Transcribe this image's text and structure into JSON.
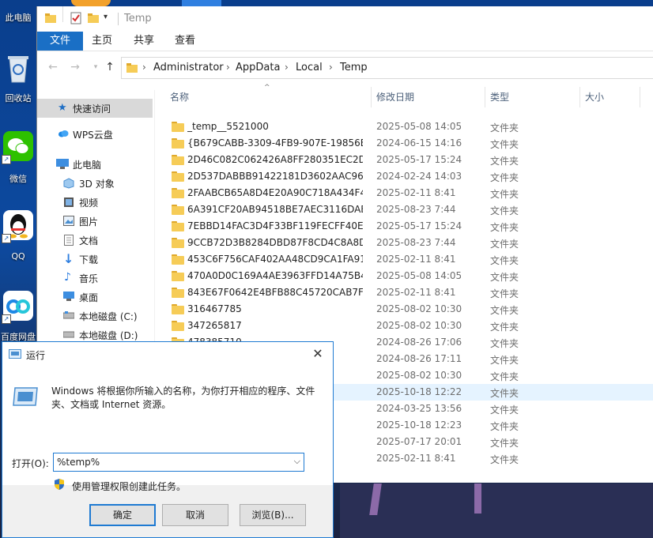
{
  "desktop": {
    "icons": [
      {
        "label": "此电脑",
        "icon": "computer-icon"
      },
      {
        "label": "回收站",
        "icon": "recycle-bin-icon"
      },
      {
        "label": "微信",
        "icon": "wechat-icon"
      },
      {
        "label": "QQ",
        "icon": "qq-icon"
      },
      {
        "label": "百度网盘",
        "icon": "baidu-netdisk-icon"
      }
    ]
  },
  "explorer": {
    "title": "Temp",
    "ribbon_tabs": [
      "文件",
      "主页",
      "共享",
      "查看"
    ],
    "breadcrumb": [
      "Administrator",
      "AppData",
      "Local",
      "Temp"
    ],
    "nav": [
      {
        "label": "快速访问",
        "icon": "star-icon"
      },
      {
        "label": "WPS云盘",
        "icon": "cloud-icon"
      },
      {
        "label": "此电脑",
        "icon": "computer-icon"
      },
      {
        "label": "3D 对象",
        "icon": "cube-icon"
      },
      {
        "label": "视频",
        "icon": "video-icon"
      },
      {
        "label": "图片",
        "icon": "picture-icon"
      },
      {
        "label": "文档",
        "icon": "document-icon"
      },
      {
        "label": "下载",
        "icon": "download-icon"
      },
      {
        "label": "音乐",
        "icon": "music-icon"
      },
      {
        "label": "桌面",
        "icon": "desktop-icon"
      },
      {
        "label": "本地磁盘 (C:)",
        "icon": "drive-icon"
      },
      {
        "label": "本地磁盘 (D:)",
        "icon": "drive-icon"
      }
    ],
    "columns": {
      "name": "名称",
      "date": "修改日期",
      "type": "类型",
      "size": "大小"
    },
    "files": [
      {
        "name": "_temp__5521000",
        "date": "2025-05-08 14:05",
        "type": "文件夹"
      },
      {
        "name": "{B679CABB-3309-4FB9-907E-19856E...",
        "date": "2024-06-15 14:16",
        "type": "文件夹"
      },
      {
        "name": "2D46C082C062426A8FF280351EC2D7...",
        "date": "2025-05-17 15:24",
        "type": "文件夹"
      },
      {
        "name": "2D537DABBB91422181D3602AAC96...",
        "date": "2024-02-24 14:03",
        "type": "文件夹"
      },
      {
        "name": "2FAABCB65A8D4E20A90C718A434F4...",
        "date": "2025-02-11 8:41",
        "type": "文件夹"
      },
      {
        "name": "6A391CF20AB94518BE7AEC3116DAB...",
        "date": "2025-08-23 7:44",
        "type": "文件夹"
      },
      {
        "name": "7EBBD14FAC3D4F33BF119FECFF40EE...",
        "date": "2025-05-17 15:24",
        "type": "文件夹"
      },
      {
        "name": "9CCB72D3B8284DBD87F8CD4C8A8D...",
        "date": "2025-08-23 7:44",
        "type": "文件夹"
      },
      {
        "name": "453C6F756CAF402AA48CD9CA1FA91...",
        "date": "2025-02-11 8:41",
        "type": "文件夹"
      },
      {
        "name": "470A0D0C169A4AE3963FFD14A75B4...",
        "date": "2025-05-08 14:05",
        "type": "文件夹"
      },
      {
        "name": "843E67F0642E4BFB88C45720CAB7FB...",
        "date": "2025-02-11 8:41",
        "type": "文件夹"
      },
      {
        "name": "316467785",
        "date": "2025-08-02 10:30",
        "type": "文件夹"
      },
      {
        "name": "347265817",
        "date": "2025-08-02 10:30",
        "type": "文件夹"
      },
      {
        "name": "478385710",
        "date": "2024-08-26 17:06",
        "type": "文件夹"
      },
      {
        "name": "",
        "date": "2024-08-26 17:11",
        "type": "文件夹"
      },
      {
        "name": "",
        "date": "2025-08-02 10:30",
        "type": "文件夹"
      },
      {
        "name": "",
        "date": "2025-10-18 12:22",
        "type": "文件夹"
      },
      {
        "name": "",
        "date": "2024-03-25 13:56",
        "type": "文件夹"
      },
      {
        "name": "",
        "date": "2025-10-18 12:23",
        "type": "文件夹"
      },
      {
        "name": "",
        "date": "2025-07-17 20:01",
        "type": "文件夹"
      },
      {
        "name": "",
        "date": "2025-02-11 8:41",
        "type": "文件夹"
      }
    ]
  },
  "run_dialog": {
    "title": "运行",
    "description": "Windows 将根据你所输入的名称，为你打开相应的程序、文件夹、文档或 Internet 资源。",
    "open_label": "打开(O):",
    "input_value": "%temp%",
    "admin_note": "使用管理权限创建此任务。",
    "buttons": {
      "ok": "确定",
      "cancel": "取消",
      "browse": "浏览(B)..."
    },
    "close_glyph": "✕"
  }
}
